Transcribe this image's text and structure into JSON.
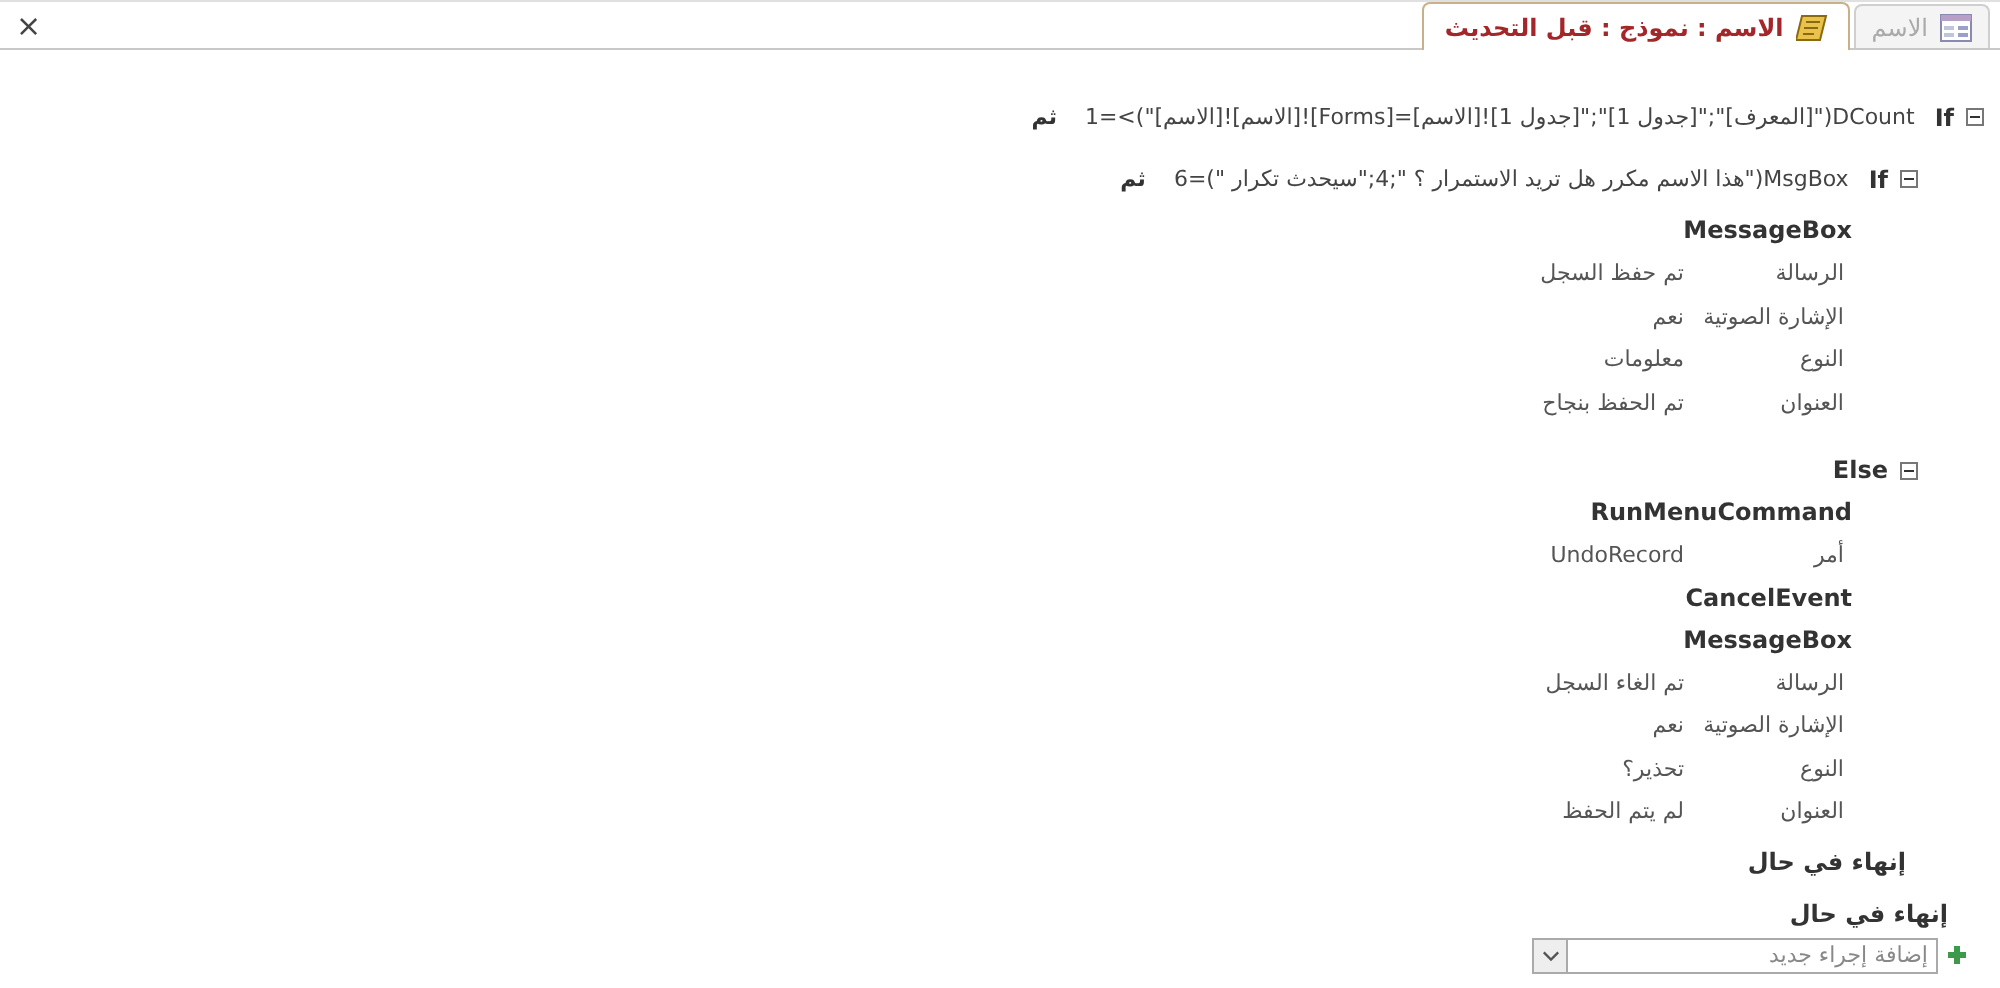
{
  "tabs": [
    {
      "label": "الاسم",
      "selected": false,
      "kind": "form"
    },
    {
      "label": "الاسم : نموذج : قبل التحديث",
      "selected": true,
      "kind": "macro"
    }
  ],
  "close_button": "×",
  "macro": {
    "steps": [
      {
        "kind": "if",
        "expanded": true,
        "keyword": "If",
        "condition": "DCount(\"[المعرف]\";\"[جدول 1]\";\"[جدول 1]![الاسم]=[Forms]![الاسم]![الاسم]\")>=1",
        "then": "ثم",
        "children": [
          {
            "kind": "if",
            "expanded": true,
            "keyword": "If",
            "condition": "MsgBox(\"هذا الاسم مكرر هل تريد الاستمرار ؟ \";4;\"سيحدث تكرار \")=6",
            "then": "ثم",
            "children": [
              {
                "kind": "action",
                "name": "MessageBox",
                "arguments": [
                  {
                    "label": "الرسالة",
                    "value": "تم حفظ السجل"
                  },
                  {
                    "label": "الإشارة الصوتية",
                    "value": "نعم"
                  },
                  {
                    "label": "النوع",
                    "value": "معلومات"
                  },
                  {
                    "label": "العنوان",
                    "value": "تم الحفظ بنجاح"
                  }
                ]
              }
            ]
          },
          {
            "kind": "else",
            "expanded": true,
            "keyword": "Else",
            "children": [
              {
                "kind": "action",
                "name": "RunMenuCommand",
                "arguments": [
                  {
                    "label": "أمر",
                    "value": "UndoRecord"
                  }
                ]
              },
              {
                "kind": "action",
                "name": "CancelEvent"
              },
              {
                "kind": "action",
                "name": "MessageBox",
                "arguments": [
                  {
                    "label": "الرسالة",
                    "value": "تم الغاء السجل"
                  },
                  {
                    "label": "الإشارة الصوتية",
                    "value": "نعم"
                  },
                  {
                    "label": "النوع",
                    "value": "تحذير؟"
                  },
                  {
                    "label": "العنوان",
                    "value": "لم يتم الحفظ"
                  }
                ]
              }
            ]
          },
          {
            "kind": "end_if",
            "text": "إنهاء في حال"
          }
        ]
      },
      {
        "kind": "end_if",
        "text": "إنهاء في حال"
      }
    ],
    "add_action": {
      "placeholder": "إضافة إجراء جديد"
    }
  }
}
